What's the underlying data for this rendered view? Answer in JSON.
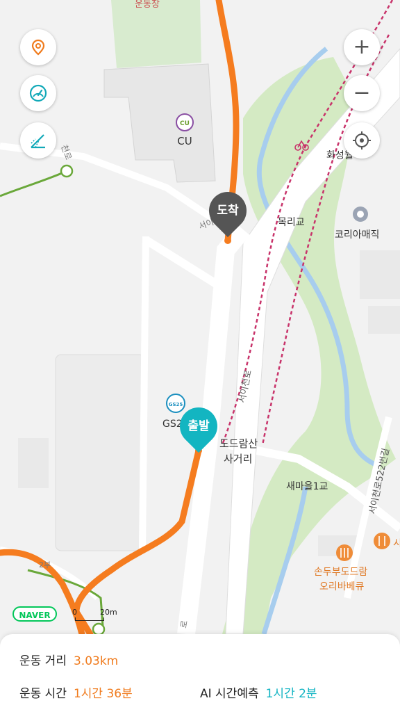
{
  "map": {
    "labels": {
      "top_cut": "운동장",
      "cu_logo": "CU",
      "cu_name": "CU",
      "road_cheon": "천로",
      "road_seoi_upper": "서이",
      "mokrigyo": "목리교",
      "hwaseong": "화성월",
      "korea_magic": "코리아매직",
      "seoicheonro": "서이천로",
      "gs_logo": "GS25",
      "gs_name": "GS2",
      "dodoramsan_1": "도드람산",
      "dodoramsan_2": "사거리",
      "saemaeul": "새마을1교",
      "seoicheonro_522": "서이천로522번길",
      "restaurant_1": "손두부도드람",
      "restaurant_2": "오리바베큐",
      "road_bu": "2부",
      "road_ro": "로",
      "restaurant_edge": "시"
    },
    "pins": {
      "arrival": "도착",
      "departure": "출발"
    },
    "colors": {
      "route": "#f57c1f",
      "trail": "#6aa83a",
      "bike": "#c8336a",
      "water": "#9cc8ea",
      "park": "#d6ebc3",
      "arrival_pin": "#555555",
      "departure_pin": "#13b5c1"
    }
  },
  "controls": {
    "location_icon": "location-pin-icon",
    "speed_icon": "speedometer-icon",
    "slope_icon": "slope-icon",
    "zoom_in": "+",
    "zoom_out": "−",
    "gps_icon": "crosshair-icon"
  },
  "brand": "NAVER",
  "scale": {
    "zero": "0",
    "distance": "20m"
  },
  "stats": {
    "distance_label": "운동 거리",
    "distance_value": "3.03km",
    "time_label": "운동 시간",
    "time_value": "1시간 36분",
    "ai_label": "AI 시간예측",
    "ai_value": "1시간 2분"
  }
}
